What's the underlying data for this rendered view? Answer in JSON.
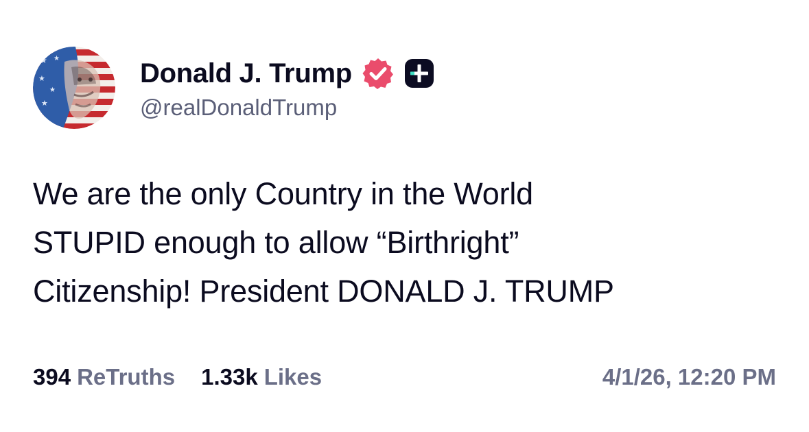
{
  "author": {
    "display_name": "Donald J. Trump",
    "handle": "@realDonaldTrump",
    "avatar_icon": "flag-portrait-avatar",
    "verified_icon": "verified-badge-icon",
    "verified_color": "#ea4c6c",
    "subscription_icon": "plus-badge-icon"
  },
  "post": {
    "lines": [
      "We are the only Country in the World",
      "STUPID enough to allow “Birthright”",
      "Citizenship! President DONALD J. TRUMP"
    ]
  },
  "stats": {
    "retruths_count": "394",
    "retruths_label": "ReTruths",
    "likes_count": "1.33k",
    "likes_label": "Likes"
  },
  "timestamp": "4/1/26, 12:20 PM"
}
